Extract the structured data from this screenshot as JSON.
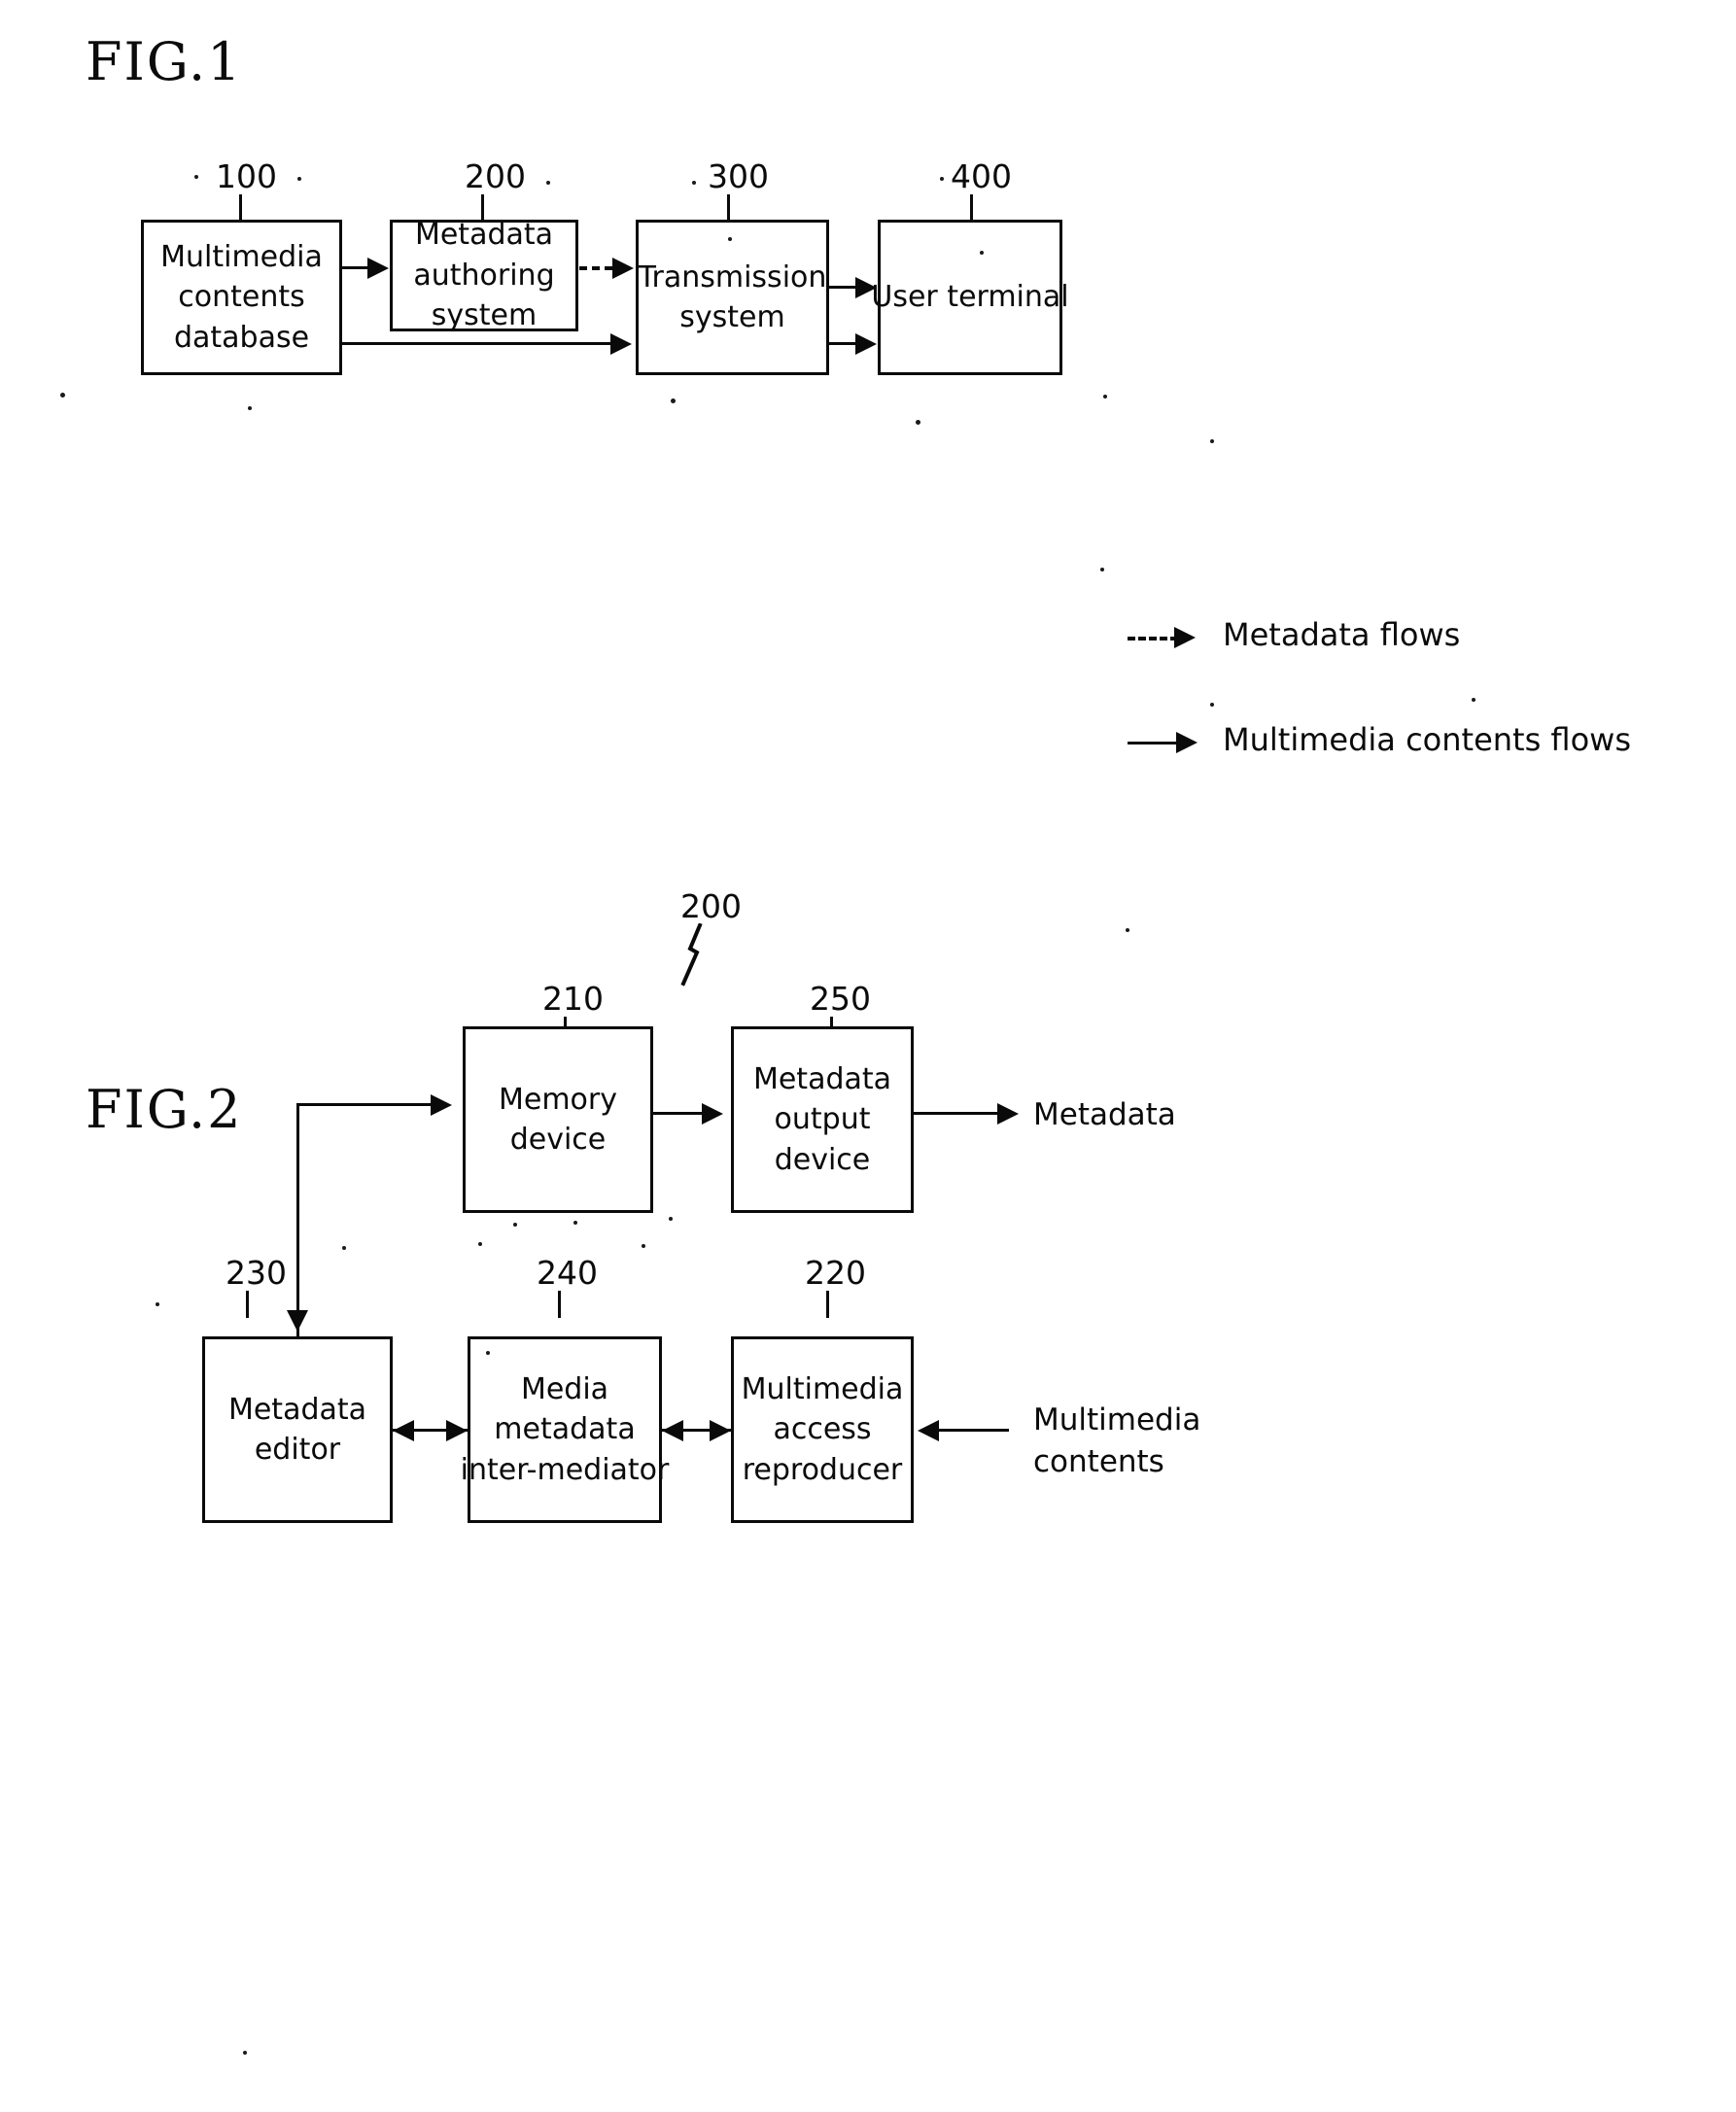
{
  "figures": [
    {
      "title": "FIG.1",
      "nodes": [
        {
          "ref": "100",
          "lines": [
            "Multimedia",
            "contents",
            "database"
          ]
        },
        {
          "ref": "200",
          "lines": [
            "Metadata",
            "authoring",
            "system"
          ]
        },
        {
          "ref": "300",
          "lines": [
            "Transmission",
            "system"
          ]
        },
        {
          "ref": "400",
          "lines": [
            "User  terminal"
          ]
        }
      ],
      "legend": [
        {
          "style": "dashed",
          "label": "Metadata  flows"
        },
        {
          "style": "solid",
          "label": "Multimedia  contents  flows"
        }
      ]
    },
    {
      "title": "FIG.2",
      "system_ref": "200",
      "nodes": [
        {
          "ref": "210",
          "lines": [
            "Memory",
            "device"
          ]
        },
        {
          "ref": "250",
          "lines": [
            "Metadata",
            "output",
            "device"
          ]
        },
        {
          "ref": "230",
          "lines": [
            "Metadata",
            "editor"
          ]
        },
        {
          "ref": "240",
          "lines": [
            "Media",
            "metadata",
            "inter-mediator"
          ]
        },
        {
          "ref": "220",
          "lines": [
            "Multimedia",
            "access",
            "reproducer"
          ]
        }
      ],
      "io_labels": [
        {
          "lines": [
            "Metadata"
          ]
        },
        {
          "lines": [
            "Multimedia",
            "contents"
          ]
        }
      ]
    }
  ]
}
